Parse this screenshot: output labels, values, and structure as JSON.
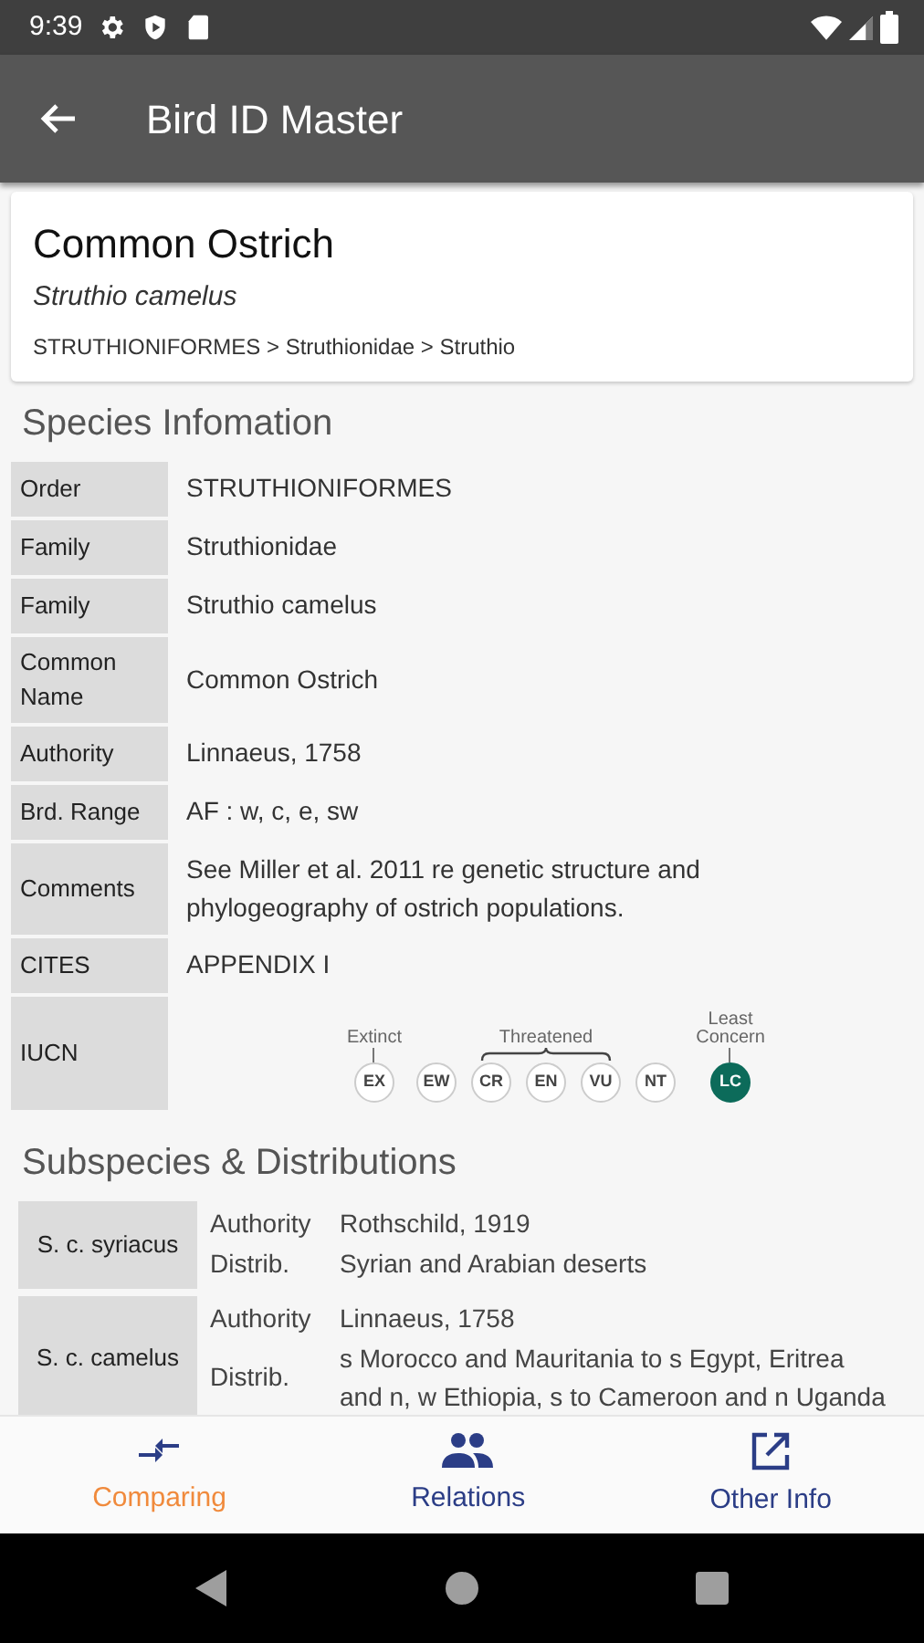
{
  "status_bar": {
    "time": "9:39"
  },
  "app_bar": {
    "title": "Bird ID Master"
  },
  "header": {
    "common_name": "Common Ostrich",
    "scientific_name": "Struthio camelus",
    "taxonomy": "STRUTHIONIFORMES > Struthionidae > Struthio"
  },
  "species_section": {
    "title": "Species Infomation",
    "rows": [
      {
        "label": "Order",
        "kind": "text",
        "value": "STRUTHIONIFORMES"
      },
      {
        "label": "Family",
        "kind": "text",
        "value": "Struthionidae"
      },
      {
        "label": "Family",
        "kind": "text",
        "value": "Struthio camelus"
      },
      {
        "label": "Common Name",
        "kind": "text",
        "value": "Common Ostrich"
      },
      {
        "label": "Authority",
        "kind": "text",
        "value": "Linnaeus, 1758"
      },
      {
        "label": "Brd. Range",
        "kind": "text",
        "value": "AF : w, c, e, sw"
      },
      {
        "label": "Comments",
        "kind": "text",
        "value": "See Miller et al. 2011 re genetic structure and phylogeography of ostrich populations."
      },
      {
        "label": "CITES",
        "kind": "text",
        "value": "APPENDIX I"
      },
      {
        "label": "IUCN",
        "kind": "iucn",
        "groups": [
          {
            "label": "Extinct",
            "kind": "tick",
            "statuses": [
              {
                "code": "EX",
                "selected": false
              }
            ]
          },
          {
            "kind": "none",
            "statuses": [
              {
                "code": "EW",
                "selected": false
              }
            ]
          },
          {
            "label": "Threatened",
            "kind": "bracket",
            "statuses": [
              {
                "code": "CR",
                "selected": false
              },
              {
                "code": "EN",
                "selected": false
              },
              {
                "code": "VU",
                "selected": false
              }
            ]
          },
          {
            "kind": "none",
            "statuses": [
              {
                "code": "NT",
                "selected": false
              }
            ]
          },
          {
            "label": "Least Concern",
            "kind": "tick",
            "statuses": [
              {
                "code": "LC",
                "selected": true
              }
            ]
          }
        ]
      }
    ]
  },
  "subspecies_section": {
    "title": "Subspecies & Distributions",
    "subspecies": [
      {
        "name": "S. c. syriacus",
        "fields": [
          {
            "label": "Authority",
            "value": "Rothschild, 1919"
          },
          {
            "label": "Distrib.",
            "value": "Syrian and Arabian deserts"
          }
        ]
      },
      {
        "name": "S. c. camelus",
        "fields": [
          {
            "label": "Authority",
            "value": "Linnaeus, 1758"
          },
          {
            "label": "Distrib.",
            "value": "s Morocco and Mauritania to s Egypt, Eritrea and n, w Ethiopia, s to Cameroon and n Uganda"
          }
        ]
      }
    ]
  },
  "bottom_nav": [
    {
      "label": "Comparing",
      "selected": true
    },
    {
      "label": "Relations",
      "selected": false
    },
    {
      "label": "Other Info",
      "selected": false
    }
  ]
}
